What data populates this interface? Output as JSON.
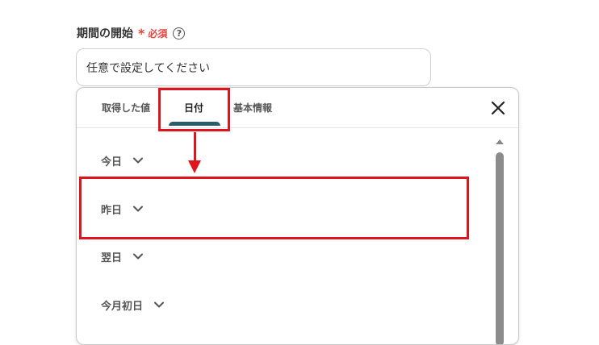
{
  "field": {
    "label": "期間の開始",
    "required_mark": "*",
    "required_text": "必須",
    "help_icon": "question-circle-icon",
    "input_value": "任意で設定してください"
  },
  "dropdown": {
    "tabs": [
      {
        "label": "取得した値"
      },
      {
        "label": "日付",
        "active": true
      },
      {
        "label": "基本情報"
      }
    ],
    "close_icon": "close-icon",
    "options": [
      {
        "label": "今日",
        "icon": "chevron-down-icon"
      },
      {
        "label": "昨日",
        "icon": "chevron-down-icon"
      },
      {
        "label": "翌日",
        "icon": "chevron-down-icon"
      },
      {
        "label": "今月初日",
        "icon": "chevron-down-icon"
      }
    ]
  },
  "annotations": {
    "highlight_color": "#e0141d",
    "highlighted_tab": "日付",
    "highlighted_option": "昨日"
  },
  "colors": {
    "required": "#e8453c",
    "active_tab_indicator": "#2a5d6c"
  }
}
